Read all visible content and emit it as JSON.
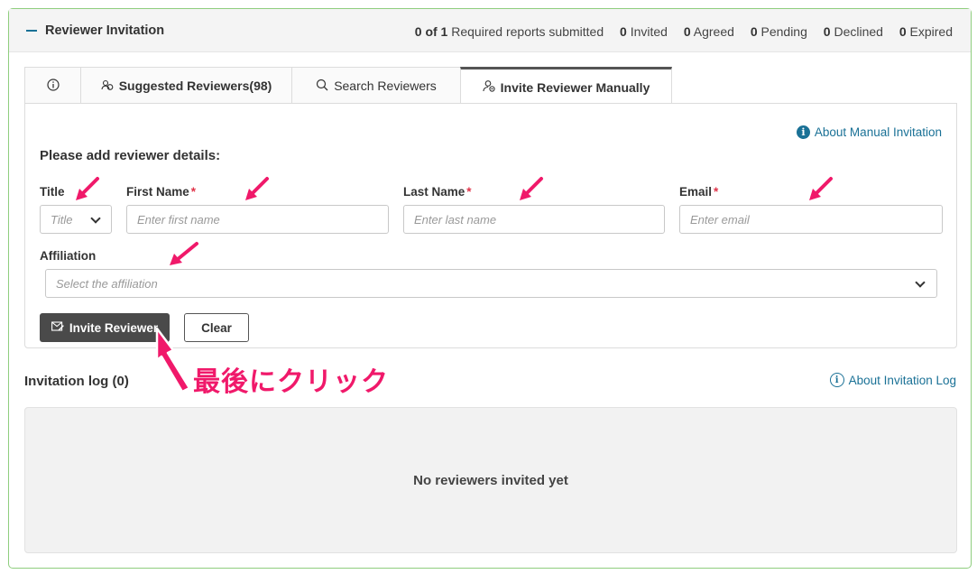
{
  "header": {
    "title": "Reviewer Invitation",
    "stats": [
      {
        "num": "0 of 1",
        "label": "Required reports submitted"
      },
      {
        "num": "0",
        "label": "Invited"
      },
      {
        "num": "0",
        "label": "Agreed"
      },
      {
        "num": "0",
        "label": "Pending"
      },
      {
        "num": "0",
        "label": "Declined"
      },
      {
        "num": "0",
        "label": "Expired"
      }
    ]
  },
  "tabs": [
    {
      "label": "",
      "icon": "info-icon"
    },
    {
      "label": "Suggested Reviewers(98)",
      "icon": "users-icon"
    },
    {
      "label": "Search Reviewers",
      "icon": "search-icon"
    },
    {
      "label": "Invite Reviewer Manually",
      "icon": "user-plus-icon",
      "active": true
    }
  ],
  "form": {
    "about_link": "About Manual Invitation",
    "heading": "Please add reviewer details:",
    "title_label": "Title",
    "title_placeholder": "Title",
    "first_name_label": "First Name",
    "first_name_placeholder": "Enter first name",
    "last_name_label": "Last Name",
    "last_name_placeholder": "Enter last name",
    "email_label": "Email",
    "email_placeholder": "Enter email",
    "required_mark": "*",
    "affiliation_label": "Affiliation",
    "affiliation_placeholder": "Select the affiliation",
    "invite_button": "Invite Reviewer",
    "clear_button": "Clear"
  },
  "log": {
    "title": "Invitation log (0)",
    "about_link": "About Invitation Log",
    "empty_message": "No reviewers invited yet"
  },
  "annotation": {
    "text": "最後にクリック",
    "color": "#f0196a"
  },
  "colors": {
    "accent": "#1a7196",
    "panel_border": "#8fce7e",
    "required": "#e0344a"
  }
}
